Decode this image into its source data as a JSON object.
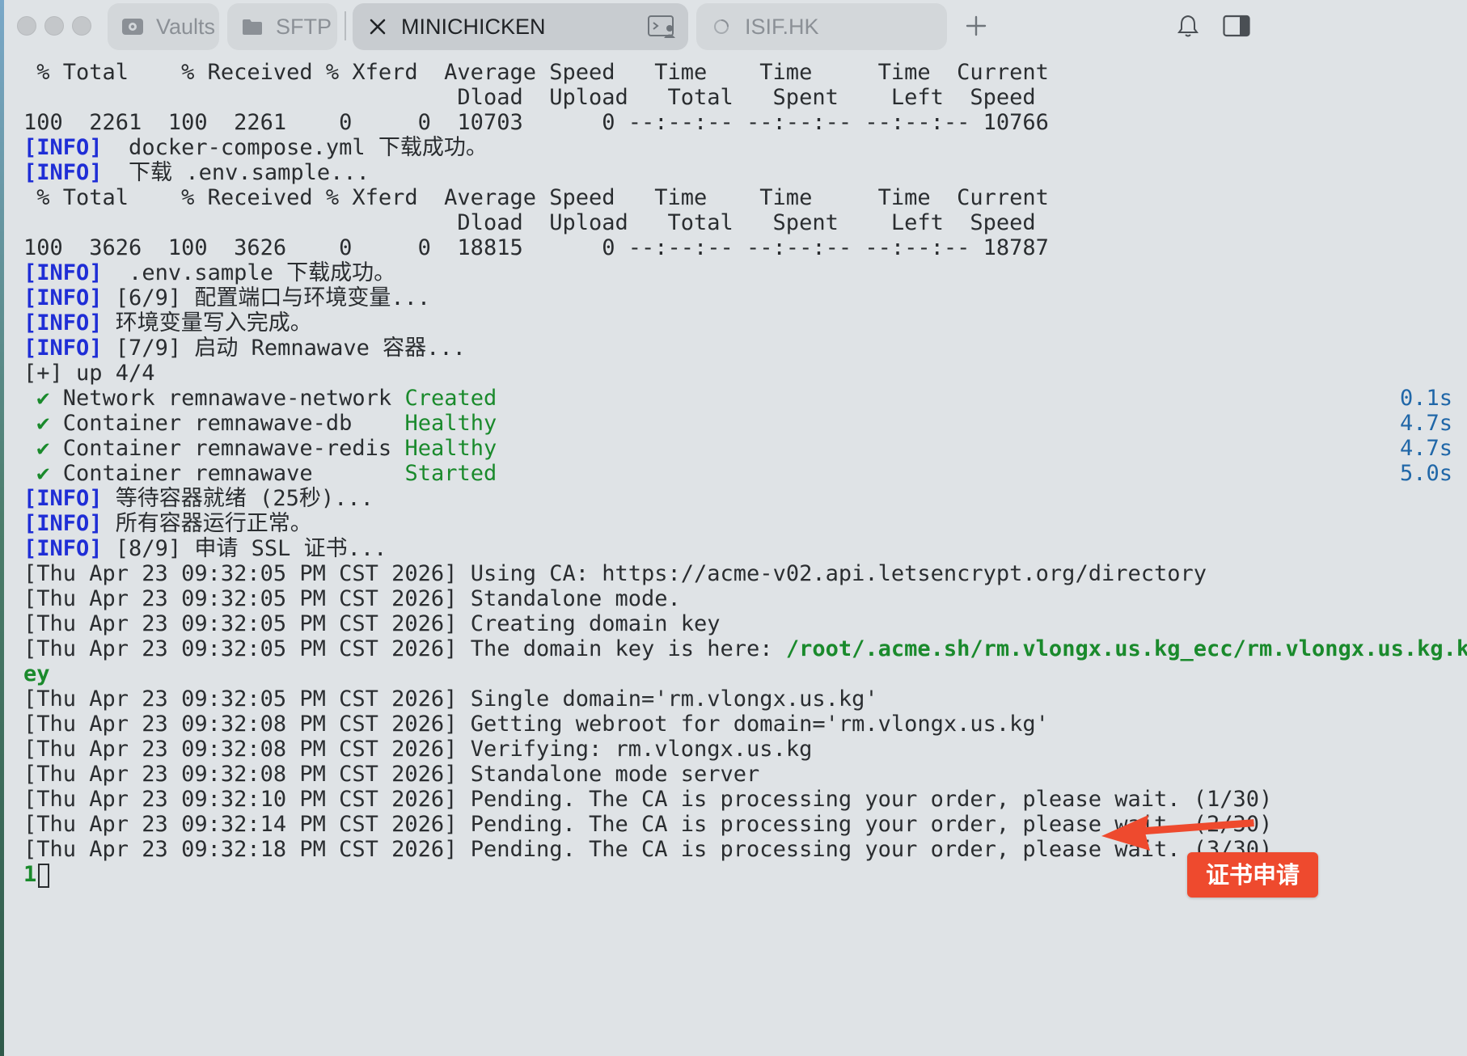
{
  "tabs": [
    {
      "label": "Vaults",
      "icon": "vault-icon",
      "active": false
    },
    {
      "label": "SFTP",
      "icon": "folder-icon",
      "active": false
    },
    {
      "label": "MINICHICKEN",
      "icon": "close-icon",
      "active": true
    },
    {
      "label": "ISIF.HK",
      "icon": "spinner-icon",
      "active": false
    }
  ],
  "toolbar": {
    "new_tab_icon": "plus-icon",
    "notifications_icon": "bell-icon",
    "sidebar_toggle_icon": "sidebar-icon",
    "terminal_profile_icon": "terminal-user-icon"
  },
  "terminal": {
    "curl1": {
      "h1": " % Total    % Received % Xferd  Average Speed   Time    Time     Time  Current",
      "h2": "                                 Dload  Upload   Total   Spent    Left  Speed",
      "row": "100  2261  100  2261    0     0  10703      0 --:--:-- --:--:-- --:--:-- 10766"
    },
    "info1": {
      "tag": "[INFO]",
      "text": "  docker-compose.yml 下载成功。"
    },
    "info2": {
      "tag": "[INFO]",
      "text": "  下载 .env.sample..."
    },
    "curl2": {
      "h1": " % Total    % Received % Xferd  Average Speed   Time    Time     Time  Current",
      "h2": "                                 Dload  Upload   Total   Spent    Left  Speed",
      "row": "100  3626  100  3626    0     0  18815      0 --:--:-- --:--:-- --:--:-- 18787"
    },
    "info3": {
      "tag": "[INFO]",
      "text": "  .env.sample 下载成功。"
    },
    "info4": {
      "tag": "[INFO]",
      "text": " [6/9] 配置端口与环境变量..."
    },
    "info5": {
      "tag": "[INFO]",
      "text": " 环境变量写入完成。"
    },
    "info6": {
      "tag": "[INFO]",
      "text": " [7/9] 启动 Remnawave 容器..."
    },
    "compose_up": "[+] up 4/4",
    "containers": [
      {
        "check": "✔",
        "name": "Network remnawave-network",
        "status": "Created",
        "duration": "0.1s"
      },
      {
        "check": "✔",
        "name": "Container remnawave-db   ",
        "status": "Healthy",
        "duration": "4.7s"
      },
      {
        "check": "✔",
        "name": "Container remnawave-redis",
        "status": "Healthy",
        "duration": "4.7s"
      },
      {
        "check": "✔",
        "name": "Container remnawave      ",
        "status": "Started",
        "duration": "5.0s"
      }
    ],
    "info7": {
      "tag": "[INFO]",
      "text": " 等待容器就绪 (25秒)..."
    },
    "info8": {
      "tag": "[INFO]",
      "text": " 所有容器运行正常。"
    },
    "info9": {
      "tag": "[INFO]",
      "text": " [8/9] 申请 SSL 证书..."
    },
    "acme": [
      {
        "ts": "[Thu Apr 23 09:32:05 PM CST 2026]",
        "msg": " Using CA: https://acme-v02.api.letsencrypt.org/directory"
      },
      {
        "ts": "[Thu Apr 23 09:32:05 PM CST 2026]",
        "msg": " Standalone mode."
      },
      {
        "ts": "[Thu Apr 23 09:32:05 PM CST 2026]",
        "msg": " Creating domain key"
      }
    ],
    "domain_key": {
      "ts": "[Thu Apr 23 09:32:05 PM CST 2026]",
      "msg": " The domain key is here: ",
      "path1": "/root/.acme.sh/rm.vlongx.us.kg_ecc/rm.vlongx.us.kg.k",
      "path2": "ey"
    },
    "acme2": [
      {
        "ts": "[Thu Apr 23 09:32:05 PM CST 2026]",
        "msg": " Single domain='rm.vlongx.us.kg'"
      },
      {
        "ts": "[Thu Apr 23 09:32:08 PM CST 2026]",
        "msg": " Getting webroot for domain='rm.vlongx.us.kg'"
      },
      {
        "ts": "[Thu Apr 23 09:32:08 PM CST 2026]",
        "msg": " Verifying: rm.vlongx.us.kg"
      },
      {
        "ts": "[Thu Apr 23 09:32:08 PM CST 2026]",
        "msg": " Standalone mode server"
      },
      {
        "ts": "[Thu Apr 23 09:32:10 PM CST 2026]",
        "msg": " Pending. The CA is processing your order, please wait. (1/30)"
      },
      {
        "ts": "[Thu Apr 23 09:32:14 PM CST 2026]",
        "msg": " Pending. The CA is processing your order, please wait. (2/30)"
      },
      {
        "ts": "[Thu Apr 23 09:32:18 PM CST 2026]",
        "msg": " Pending. The CA is processing your order, please wait. (3/30)"
      }
    ],
    "prompt_input": "1"
  },
  "annotation": {
    "label": "证书申请",
    "color": "#ee4a2e"
  },
  "colors": {
    "info": "#1f2ed6",
    "success": "#1a8a2c",
    "duration": "#2067a8",
    "background": "#dfe3e6"
  }
}
